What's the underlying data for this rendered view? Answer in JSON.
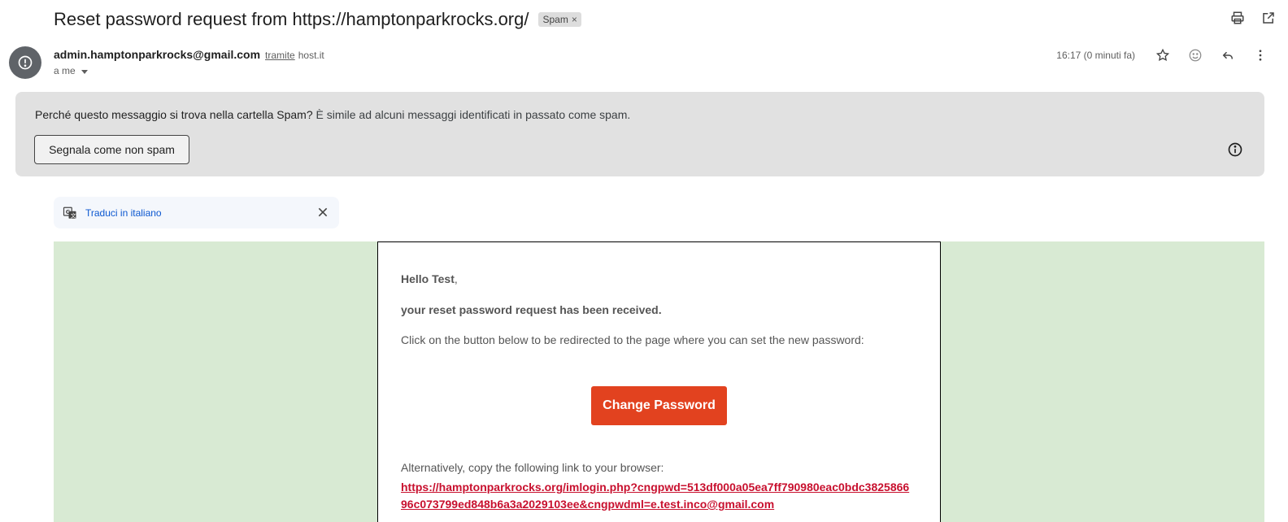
{
  "email": {
    "subject": "Reset password request from https://hamptonparkrocks.org/",
    "label": "Spam",
    "label_remove": "×",
    "sender": "admin.hamptonparkrocks@gmail.com",
    "via_label": "tramite",
    "via_domain": "host.it",
    "recipient": "a me",
    "time": "16:17 (0 minuti fa)"
  },
  "spam_banner": {
    "question": "Perché questo messaggio si trova nella cartella Spam?",
    "explanation": "È simile ad alcuni messaggi identificati in passato come spam.",
    "not_spam_button": "Segnala come non spam"
  },
  "translate": {
    "link": "Traduci in italiano"
  },
  "body": {
    "greeting_name": "Hello Test",
    "greeting_punct": ",",
    "received": "your reset password request has been received.",
    "instructions": "Click on the button below to be redirected to the page where you can set the new password:",
    "button": "Change Password",
    "alternative": "Alternatively, copy the following link to your browser:",
    "link": "https://hamptonparkrocks.org/imlogin.php?cngpwd=513df000a05ea7ff790980eac0bdc382586696c073799ed848b6a3a2029103ee&cngpwdml=e.test.inco@gmail.com"
  },
  "colors": {
    "spam_banner_bg": "#e1e1e1",
    "mail_bg": "#d8ead3",
    "button_bg": "#e2421f",
    "link": "#c8102e",
    "translate_link": "#0b57d0"
  },
  "icons": {
    "print": "print-icon",
    "open_new_window": "open-in-new-icon",
    "avatar": "warning-avatar-icon",
    "star": "star-icon",
    "emoji": "emoji-icon",
    "reply": "reply-icon",
    "more": "more-vert-icon",
    "info": "info-icon",
    "translate": "translate-icon",
    "close": "close-icon"
  }
}
